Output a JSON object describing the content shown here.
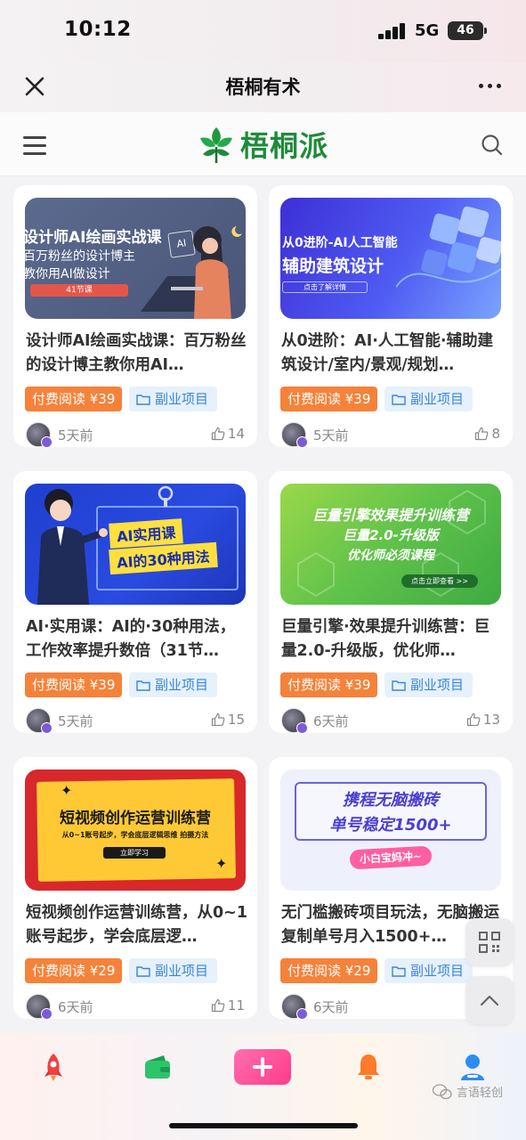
{
  "status_bar": {
    "time": "10:12",
    "network": "5G",
    "battery": "46"
  },
  "title_bar": {
    "title": "梧桐有术"
  },
  "site": {
    "logo_text": "梧桐派"
  },
  "colors": {
    "brand_green": "#1e8b3a",
    "price_orange": "#f5823a",
    "tag_blue": "#3a86d8",
    "plus_pink": "#ff4f96"
  },
  "cards": [
    {
      "thumb": {
        "line1": "设计师AI绘画实战课",
        "line2": "百万粉丝的设计博主",
        "line3": "教你用AI做设计",
        "badge": "41节课",
        "corner": "AI"
      },
      "title": "设计师AI绘画实战课：百万粉丝的设计博主教你用AI…",
      "price": "付费阅读 ¥39",
      "category": "副业项目",
      "time": "5天前",
      "likes": "14"
    },
    {
      "thumb": {
        "line1": "从0进阶-AI人工智能",
        "line2": "辅助建筑设计",
        "badge": "点击了解详情"
      },
      "title": "从0进阶：AI·人工智能·辅助建筑设计/室内/景观/规划…",
      "price": "付费阅读 ¥39",
      "category": "副业项目",
      "time": "5天前",
      "likes": "8"
    },
    {
      "thumb": {
        "line1": "AI实用课",
        "line2": "AI的30种用法"
      },
      "title": "AI·实用课：AI的·30种用法，工作效率提升数倍（31节…",
      "price": "付费阅读 ¥39",
      "category": "副业项目",
      "time": "5天前",
      "likes": "15"
    },
    {
      "thumb": {
        "line1": "巨量引擎效果提升训练营",
        "line2": "巨量2.0-升级版",
        "line3": "优化师必须课程",
        "badge": "点击立即查看 >>"
      },
      "title": "巨量引擎·效果提升训练营：巨量2.0-升级版，优化师…",
      "price": "付费阅读 ¥39",
      "category": "副业项目",
      "time": "6天前",
      "likes": "13"
    },
    {
      "thumb": {
        "line1": "短视频创作运营训练营",
        "line2": "从0~1账号起步，学会底层逻辑思维 拍摄方法",
        "badge": "立即学习"
      },
      "title": "短视频创作运营训练营，从0~1账号起步，学会底层逻…",
      "price": "付费阅读 ¥29",
      "category": "副业项目",
      "time": "6天前",
      "likes": "11"
    },
    {
      "thumb": {
        "line1": "携程无脑搬砖",
        "line2": "单号稳定1500+",
        "badge": "小白宝妈冲~"
      },
      "title": "无门槛搬砖项目玩法，无脑搬运复制单号月入1500+…",
      "price": "付费阅读 ¥29",
      "category": "副业项目",
      "time": "6天前",
      "likes": ""
    }
  ],
  "watermark": {
    "text": "言语轻创"
  },
  "icons": [
    "close-icon",
    "more-icon",
    "menu-icon",
    "search-icon",
    "folder-icon",
    "thumb-up-icon",
    "qr-code-icon",
    "chevron-up-icon",
    "rocket-icon",
    "wallet-icon",
    "plus-icon",
    "bell-icon",
    "user-icon",
    "wechat-icon"
  ]
}
